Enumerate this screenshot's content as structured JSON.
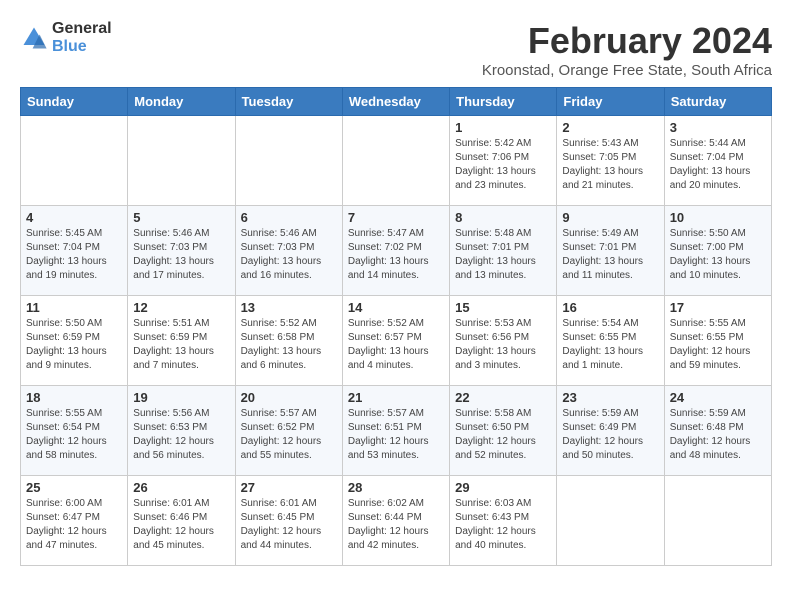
{
  "logo": {
    "general": "General",
    "blue": "Blue"
  },
  "title": "February 2024",
  "subtitle": "Kroonstad, Orange Free State, South Africa",
  "days": [
    "Sunday",
    "Monday",
    "Tuesday",
    "Wednesday",
    "Thursday",
    "Friday",
    "Saturday"
  ],
  "weeks": [
    [
      {
        "date": "",
        "info": ""
      },
      {
        "date": "",
        "info": ""
      },
      {
        "date": "",
        "info": ""
      },
      {
        "date": "",
        "info": ""
      },
      {
        "date": "1",
        "info": "Sunrise: 5:42 AM\nSunset: 7:06 PM\nDaylight: 13 hours\nand 23 minutes."
      },
      {
        "date": "2",
        "info": "Sunrise: 5:43 AM\nSunset: 7:05 PM\nDaylight: 13 hours\nand 21 minutes."
      },
      {
        "date": "3",
        "info": "Sunrise: 5:44 AM\nSunset: 7:04 PM\nDaylight: 13 hours\nand 20 minutes."
      }
    ],
    [
      {
        "date": "4",
        "info": "Sunrise: 5:45 AM\nSunset: 7:04 PM\nDaylight: 13 hours\nand 19 minutes."
      },
      {
        "date": "5",
        "info": "Sunrise: 5:46 AM\nSunset: 7:03 PM\nDaylight: 13 hours\nand 17 minutes."
      },
      {
        "date": "6",
        "info": "Sunrise: 5:46 AM\nSunset: 7:03 PM\nDaylight: 13 hours\nand 16 minutes."
      },
      {
        "date": "7",
        "info": "Sunrise: 5:47 AM\nSunset: 7:02 PM\nDaylight: 13 hours\nand 14 minutes."
      },
      {
        "date": "8",
        "info": "Sunrise: 5:48 AM\nSunset: 7:01 PM\nDaylight: 13 hours\nand 13 minutes."
      },
      {
        "date": "9",
        "info": "Sunrise: 5:49 AM\nSunset: 7:01 PM\nDaylight: 13 hours\nand 11 minutes."
      },
      {
        "date": "10",
        "info": "Sunrise: 5:50 AM\nSunset: 7:00 PM\nDaylight: 13 hours\nand 10 minutes."
      }
    ],
    [
      {
        "date": "11",
        "info": "Sunrise: 5:50 AM\nSunset: 6:59 PM\nDaylight: 13 hours\nand 9 minutes."
      },
      {
        "date": "12",
        "info": "Sunrise: 5:51 AM\nSunset: 6:59 PM\nDaylight: 13 hours\nand 7 minutes."
      },
      {
        "date": "13",
        "info": "Sunrise: 5:52 AM\nSunset: 6:58 PM\nDaylight: 13 hours\nand 6 minutes."
      },
      {
        "date": "14",
        "info": "Sunrise: 5:52 AM\nSunset: 6:57 PM\nDaylight: 13 hours\nand 4 minutes."
      },
      {
        "date": "15",
        "info": "Sunrise: 5:53 AM\nSunset: 6:56 PM\nDaylight: 13 hours\nand 3 minutes."
      },
      {
        "date": "16",
        "info": "Sunrise: 5:54 AM\nSunset: 6:55 PM\nDaylight: 13 hours\nand 1 minute."
      },
      {
        "date": "17",
        "info": "Sunrise: 5:55 AM\nSunset: 6:55 PM\nDaylight: 12 hours\nand 59 minutes."
      }
    ],
    [
      {
        "date": "18",
        "info": "Sunrise: 5:55 AM\nSunset: 6:54 PM\nDaylight: 12 hours\nand 58 minutes."
      },
      {
        "date": "19",
        "info": "Sunrise: 5:56 AM\nSunset: 6:53 PM\nDaylight: 12 hours\nand 56 minutes."
      },
      {
        "date": "20",
        "info": "Sunrise: 5:57 AM\nSunset: 6:52 PM\nDaylight: 12 hours\nand 55 minutes."
      },
      {
        "date": "21",
        "info": "Sunrise: 5:57 AM\nSunset: 6:51 PM\nDaylight: 12 hours\nand 53 minutes."
      },
      {
        "date": "22",
        "info": "Sunrise: 5:58 AM\nSunset: 6:50 PM\nDaylight: 12 hours\nand 52 minutes."
      },
      {
        "date": "23",
        "info": "Sunrise: 5:59 AM\nSunset: 6:49 PM\nDaylight: 12 hours\nand 50 minutes."
      },
      {
        "date": "24",
        "info": "Sunrise: 5:59 AM\nSunset: 6:48 PM\nDaylight: 12 hours\nand 48 minutes."
      }
    ],
    [
      {
        "date": "25",
        "info": "Sunrise: 6:00 AM\nSunset: 6:47 PM\nDaylight: 12 hours\nand 47 minutes."
      },
      {
        "date": "26",
        "info": "Sunrise: 6:01 AM\nSunset: 6:46 PM\nDaylight: 12 hours\nand 45 minutes."
      },
      {
        "date": "27",
        "info": "Sunrise: 6:01 AM\nSunset: 6:45 PM\nDaylight: 12 hours\nand 44 minutes."
      },
      {
        "date": "28",
        "info": "Sunrise: 6:02 AM\nSunset: 6:44 PM\nDaylight: 12 hours\nand 42 minutes."
      },
      {
        "date": "29",
        "info": "Sunrise: 6:03 AM\nSunset: 6:43 PM\nDaylight: 12 hours\nand 40 minutes."
      },
      {
        "date": "",
        "info": ""
      },
      {
        "date": "",
        "info": ""
      }
    ]
  ]
}
